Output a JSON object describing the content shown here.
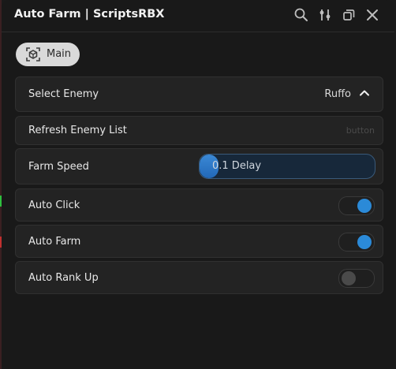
{
  "window": {
    "title": "Auto Farm | ScriptsRBX"
  },
  "tabs": [
    {
      "label": "Main",
      "icon": "target-icon",
      "active": true
    }
  ],
  "elements": {
    "select_enemy": {
      "label": "Select Enemy",
      "value": "Ruffo"
    },
    "refresh": {
      "label": "Refresh Enemy List",
      "hint": "button"
    },
    "farm_speed": {
      "label": "Farm Speed",
      "value_text": "0.1 Delay",
      "fill_fraction": 0.11
    },
    "auto_click": {
      "label": "Auto Click",
      "on": true
    },
    "auto_farm": {
      "label": "Auto Farm",
      "on": true
    },
    "auto_rank": {
      "label": "Auto Rank Up",
      "on": false
    }
  },
  "colors": {
    "accent": "#2b8ad8",
    "background": "#191919",
    "row": "#232323"
  }
}
